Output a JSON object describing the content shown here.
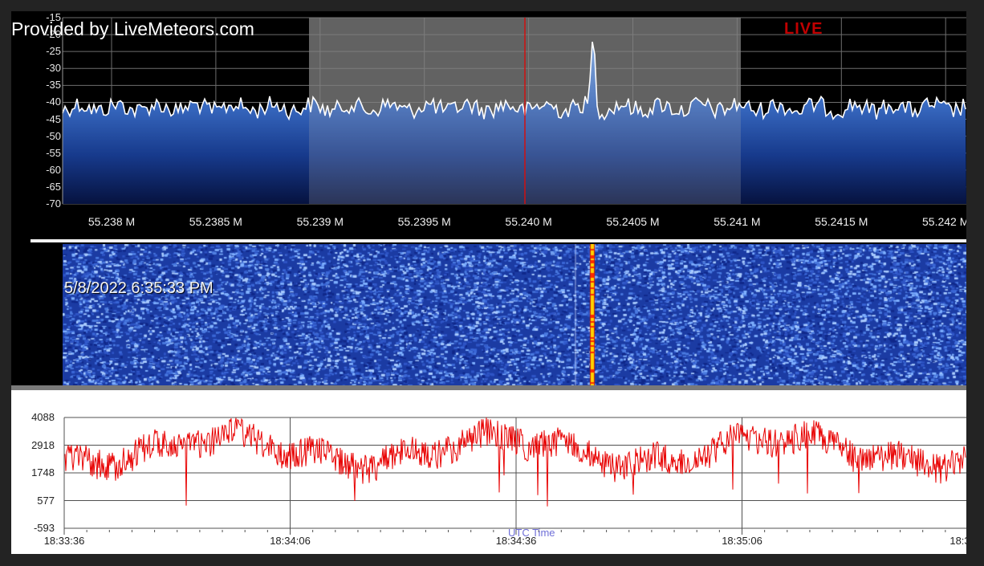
{
  "provider": "Provided by LiveMeteors.com",
  "live_label": "LIVE",
  "spectrum": {
    "y_ticks": [
      "-15",
      "-20",
      "-25",
      "-30",
      "-35",
      "-40",
      "-45",
      "-50",
      "-55",
      "-60",
      "-65",
      "-70"
    ],
    "x_ticks": [
      "55.238 M",
      "55.2385 M",
      "55.239 M",
      "55.2395 M",
      "55.240 M",
      "55.2405 M",
      "55.241 M",
      "55.2415 M",
      "55.242 M"
    ],
    "colors": {
      "fill_top": "#6a9be0",
      "fill_bottom": "#0a1a55",
      "trace": "#ffffff",
      "marker": "#d01010",
      "grid": "#6e6e6e",
      "selection": "#8a8a8a"
    }
  },
  "waterfall": {
    "timestamp": "5/8/2022 6:35:33 PM",
    "colors": {
      "background": "#1b3ba3",
      "speckle": "#7fb0ff",
      "signal": "#ff3000",
      "signal_core": "#ffe000"
    }
  },
  "signal_panel": {
    "y_ticks": [
      "4088",
      "2918",
      "1748",
      "577",
      "-593"
    ],
    "x_ticks": [
      "18:33:36",
      "18:34:06",
      "18:34:36",
      "18:35:06",
      "18:3"
    ],
    "x_axis_label": "UTC Time",
    "colors": {
      "trace": "#e80000",
      "grid": "#505050"
    }
  }
}
